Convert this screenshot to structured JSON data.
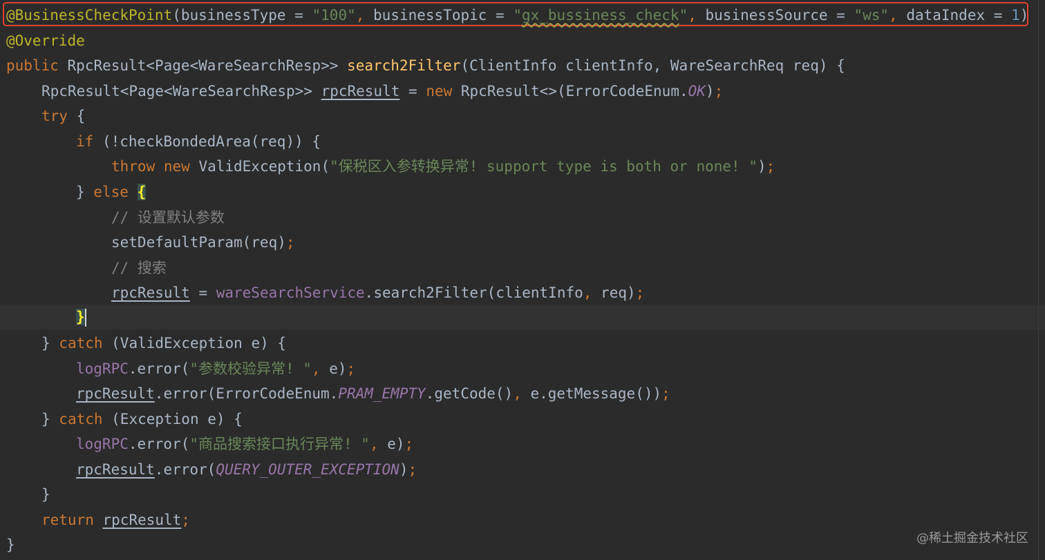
{
  "editor": {
    "lines": {
      "l1": {
        "annotation": "@BusinessCheckPoint",
        "open": "(businessType = ",
        "type_val": "\"100\"",
        "comma1": ", ",
        "topic_key": "businessTopic = ",
        "topic_q1": "\"",
        "topic_val": "gx_bussiness_check",
        "topic_q2": "\"",
        "comma2": ", ",
        "source_key": "businessSource = ",
        "source_val": "\"ws\"",
        "comma3": ", ",
        "index_key": "dataIndex = ",
        "index_val": "1",
        "close": ")"
      },
      "l2": {
        "annotation": "@Override"
      },
      "l3": {
        "kw": "public ",
        "type": "RpcResult<Page<WareSearchResp>> ",
        "method": "search2Filter",
        "params": "(ClientInfo clientInfo, WareSearchReq req) {"
      },
      "l4": {
        "type": "RpcResult<Page<WareSearchResp>> ",
        "var": "rpcResult",
        "assign": " = ",
        "kw_new": "new ",
        "ctor": "RpcResult<>(ErrorCodeEnum.",
        "const": "OK",
        "end": ")",
        "semi": ";"
      },
      "l5": {
        "kw": "try",
        "rest": " {"
      },
      "l6": {
        "kw": "if",
        "rest": " (!checkBondedArea(req)) {"
      },
      "l7": {
        "kw_throw": "throw ",
        "kw_new": "new ",
        "cls": "ValidException(",
        "str": "\"保税区入参转换异常! support type is both or none! \"",
        "end": ")",
        "semi": ";"
      },
      "l8": {
        "close": "} ",
        "kw": "else",
        "space": " ",
        "brace": "{"
      },
      "l9": {
        "comment": "// 设置默认参数"
      },
      "l10": {
        "call": "setDefaultParam(req)",
        "semi": ";"
      },
      "l11": {
        "comment": "// 搜索"
      },
      "l12": {
        "var": "rpcResult",
        "assign": " = ",
        "field": "wareSearchService",
        "call": ".search2Filter(clientInfo",
        "comma": ", ",
        "args": "req)",
        "semi": ";"
      },
      "l13": {
        "brace": "}"
      },
      "l14": {
        "close": "} ",
        "kw": "catch",
        "rest": " (ValidException e) {"
      },
      "l15": {
        "field": "logRPC",
        "call": ".error(",
        "str": "\"参数校验异常! \"",
        "comma": ", ",
        "arg": "e)",
        "semi": ";"
      },
      "l16": {
        "var": "rpcResult",
        "call": ".error(ErrorCodeEnum.",
        "const": "PRAM_EMPTY",
        "call2": ".getCode()",
        "comma": ", ",
        "arg": "e.getMessage())",
        "semi": ";"
      },
      "l17": {
        "close": "} ",
        "kw": "catch",
        "rest": " (Exception e) {"
      },
      "l18": {
        "field": "logRPC",
        "call": ".error(",
        "str": "\"商品搜索接口执行异常! \"",
        "comma": ", ",
        "arg": "e)",
        "semi": ";"
      },
      "l19": {
        "var": "rpcResult",
        "call": ".error(",
        "const": "QUERY_OUTER_EXCEPTION",
        "end": ")",
        "semi": ";"
      },
      "l20": {
        "close": "}"
      },
      "l21": {
        "kw": "return ",
        "var": "rpcResult",
        "semi": ";"
      },
      "l22": {
        "close": "}"
      }
    }
  },
  "watermark": "@稀土掘金技术社区",
  "colors": {
    "background": "#2b2b2b",
    "keyword": "#cc7832",
    "string": "#6a8759",
    "annotation": "#bbb529",
    "number": "#6897bb",
    "method": "#ffc66d",
    "field": "#9876aa",
    "comment": "#808080",
    "highlight_box": "#e3412f"
  }
}
